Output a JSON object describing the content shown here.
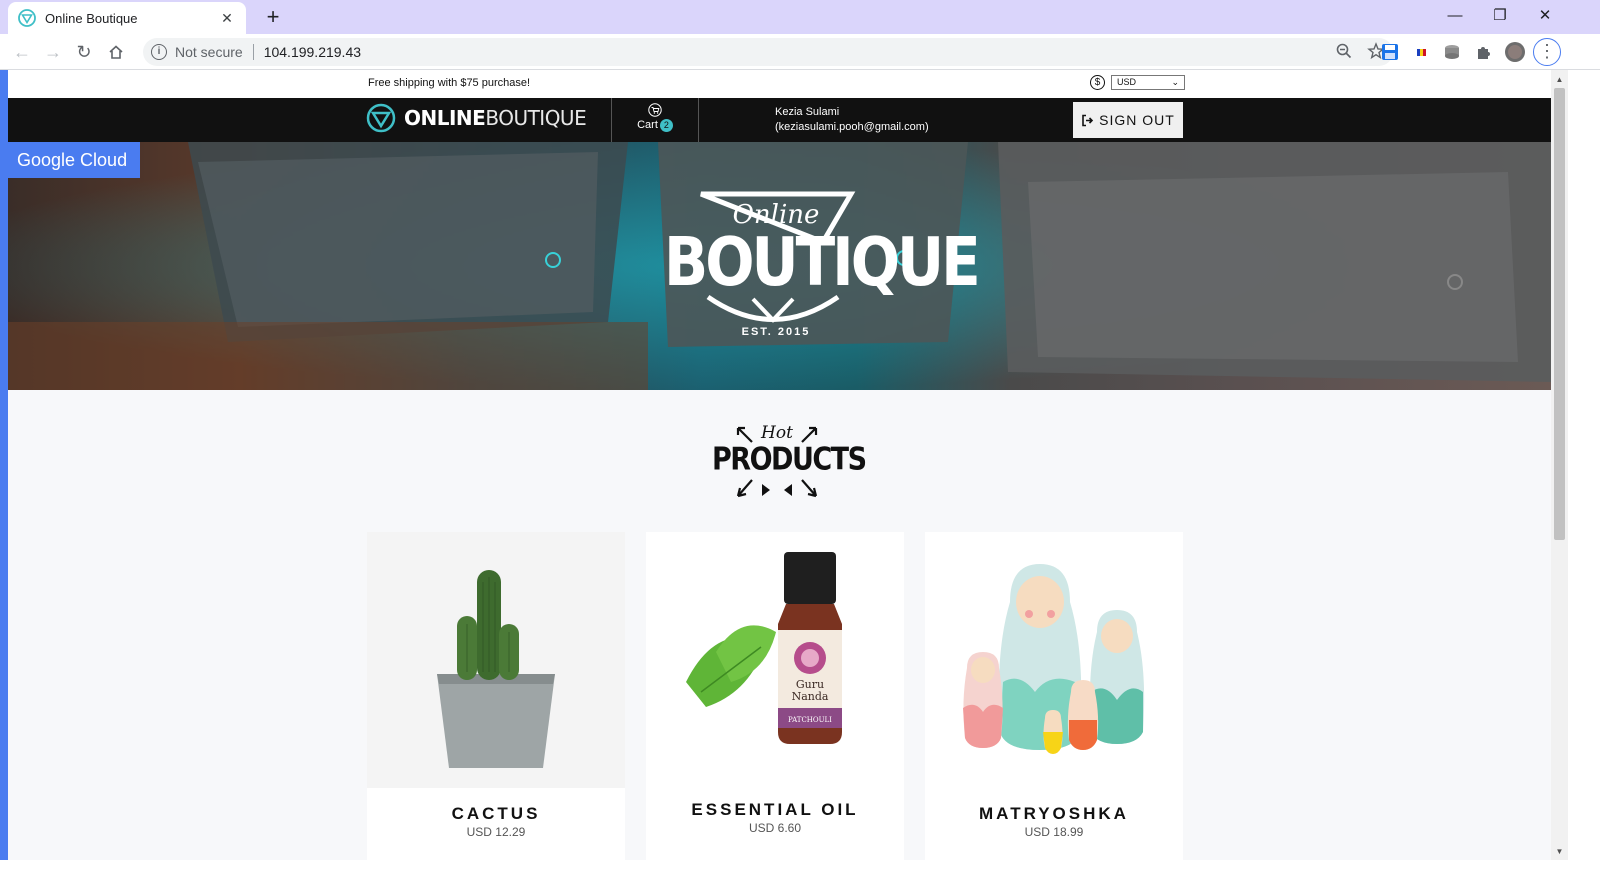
{
  "browser": {
    "tab_title": "Online Boutique",
    "new_tab": "+",
    "security_label": "Not secure",
    "url": "104.199.219.43",
    "window_controls": [
      "—",
      "❐",
      "✕"
    ]
  },
  "topbar": {
    "shipping": "Free shipping with $75 purchase!",
    "currency_symbol": "$",
    "currency_selected": "USD"
  },
  "header": {
    "logo_bold": "ONLINE",
    "logo_light": "BOUTIQUE",
    "cart_label": "Cart",
    "cart_count": "2",
    "user_name": "Kezia Sulami",
    "user_email": "(keziasulami.pooh@gmail.com)",
    "signout_label": "SIGN OUT"
  },
  "hero": {
    "badge": "Google Cloud",
    "logo_script": "Online",
    "logo_main": "BOUTIQUE",
    "logo_est": "EST. 2015"
  },
  "hot_products": {
    "script": "Hot",
    "main": "PRODUCTS"
  },
  "products": [
    {
      "name": "CACTUS",
      "price": "USD 12.29",
      "icon": "cactus-image"
    },
    {
      "name": "ESSENTIAL OIL",
      "price": "USD 6.60",
      "icon": "essential-oil-image"
    },
    {
      "name": "MATRYOSHKA",
      "price": "USD 18.99",
      "icon": "matryoshka-image"
    }
  ],
  "colors": {
    "accent": "#3fbfc7",
    "header_bg": "#111111",
    "gcloud_blue": "#4a7cf0",
    "tabbar": "#dad5fb"
  }
}
